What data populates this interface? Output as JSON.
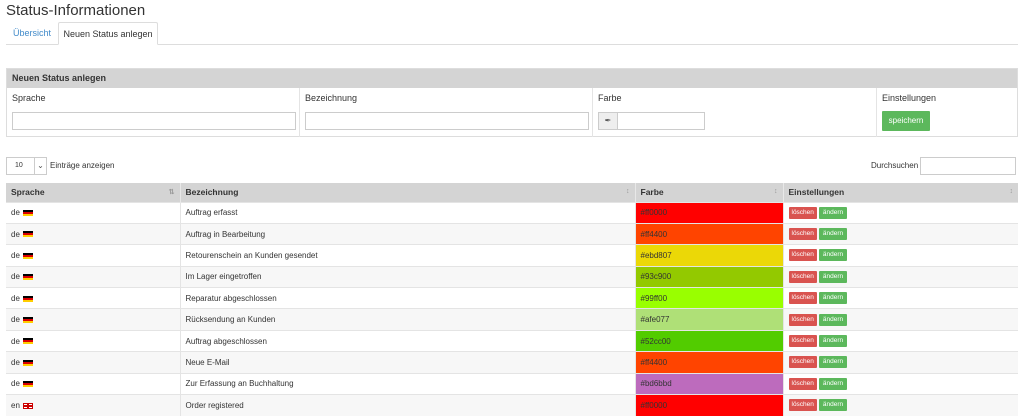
{
  "page": {
    "title": "Status-Informationen"
  },
  "tabs": [
    {
      "label": "Übersicht",
      "active": false
    },
    {
      "label": "Neuen Status anlegen",
      "active": true
    }
  ],
  "form": {
    "heading": "Neuen Status anlegen",
    "columns": {
      "language": "Sprache",
      "name": "Bezeichnung",
      "color": "Farbe",
      "settings": "Einstellungen"
    },
    "language_value": "",
    "name_value": "",
    "color_value": "",
    "save_label": "speichern",
    "save_color": "#5cb85c"
  },
  "table_controls": {
    "length_value": "10",
    "length_label": "Einträge anzeigen",
    "search_label": "Durchsuchen",
    "search_value": ""
  },
  "table": {
    "columns": [
      "Sprache",
      "Bezeichnung",
      "Farbe",
      "Einstellungen"
    ],
    "delete_label": "löschen",
    "edit_label": "ändern",
    "rows": [
      {
        "lang": "de",
        "flag": "de",
        "name": "Auftrag erfasst",
        "color": "#ff0000"
      },
      {
        "lang": "de",
        "flag": "de",
        "name": "Auftrag in Bearbeitung",
        "color": "#ff4400"
      },
      {
        "lang": "de",
        "flag": "de",
        "name": "Retourenschein an Kunden gesendet",
        "color": "#ebd807"
      },
      {
        "lang": "de",
        "flag": "de",
        "name": "Im Lager eingetroffen",
        "color": "#93c900"
      },
      {
        "lang": "de",
        "flag": "de",
        "name": "Reparatur abgeschlossen",
        "color": "#99ff00"
      },
      {
        "lang": "de",
        "flag": "de",
        "name": "Rücksendung an Kunden",
        "color": "#afe077"
      },
      {
        "lang": "de",
        "flag": "de",
        "name": "Auftrag abgeschlossen",
        "color": "#52cc00"
      },
      {
        "lang": "de",
        "flag": "de",
        "name": "Neue E-Mail",
        "color": "#ff4400"
      },
      {
        "lang": "de",
        "flag": "de",
        "name": "Zur Erfassung an Buchhaltung",
        "color": "#bd6bbd"
      },
      {
        "lang": "en",
        "flag": "en",
        "name": "Order registered",
        "color": "#ff0000"
      }
    ]
  }
}
